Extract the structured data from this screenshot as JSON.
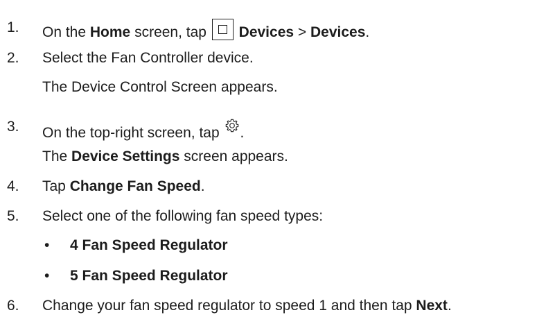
{
  "steps": [
    {
      "number": "1.",
      "parts": {
        "a": "On the ",
        "b_home": "Home",
        "c": " screen, tap ",
        "d_devices1": "Devices",
        "e_sep": " > ",
        "f_devices2": "Devices",
        "g_end": "."
      }
    },
    {
      "number": "2.",
      "text": "Select the Fan Controller device.",
      "result": "The Device Control Screen appears."
    },
    {
      "number": "3.",
      "parts": {
        "a": "On the top-right screen, tap ",
        "end": "."
      },
      "result": {
        "a": "The ",
        "b_bold": "Device Settings",
        "c": " screen appears."
      }
    },
    {
      "number": "4.",
      "parts": {
        "a": "Tap ",
        "b_bold": "Change Fan Speed",
        "c": "."
      }
    },
    {
      "number": "5.",
      "text": "Select one of the following fan speed types:",
      "bullets": [
        {
          "symbol": "•",
          "label": "4 Fan Speed Regulator"
        },
        {
          "symbol": "•",
          "label": "5 Fan Speed Regulator"
        }
      ]
    },
    {
      "number": "6.",
      "parts": {
        "a": "Change your fan speed regulator to speed 1 and then tap ",
        "b_bold": "Next",
        "c": "."
      }
    }
  ],
  "icons": {
    "home": "home-square-icon",
    "settings": "gear-icon"
  }
}
